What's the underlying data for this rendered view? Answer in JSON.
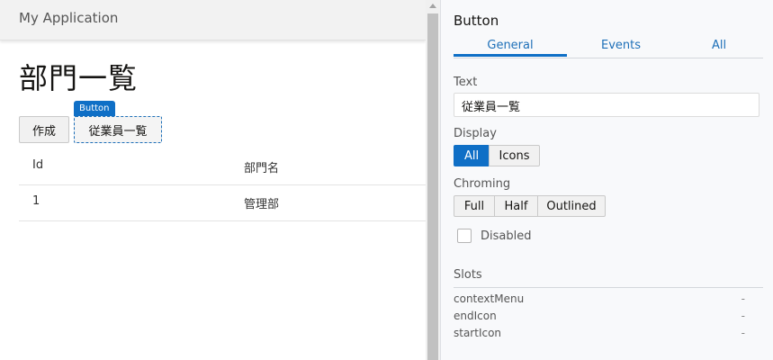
{
  "app": {
    "title": "My Application"
  },
  "page": {
    "heading": "部門一覧",
    "create_button": "作成",
    "employees_button": "従業員一覧",
    "selection_badge": "Button"
  },
  "table": {
    "columns": [
      "Id",
      "部門名"
    ],
    "rows": [
      [
        "1",
        "管理部"
      ]
    ]
  },
  "panel": {
    "title": "Button",
    "tabs": [
      {
        "label": "General",
        "active": true
      },
      {
        "label": "Events",
        "active": false
      },
      {
        "label": "All",
        "active": false
      }
    ],
    "text_label": "Text",
    "text_value": "従業員一覧",
    "display_label": "Display",
    "display_options": [
      {
        "label": "All",
        "active": true
      },
      {
        "label": "Icons",
        "active": false
      }
    ],
    "chroming_label": "Chroming",
    "chroming_options": [
      {
        "label": "Full",
        "active": false
      },
      {
        "label": "Half",
        "active": false
      },
      {
        "label": "Outlined",
        "active": false
      }
    ],
    "disabled_label": "Disabled",
    "disabled_checked": false,
    "slots_label": "Slots",
    "slots": [
      {
        "name": "contextMenu",
        "value": "-"
      },
      {
        "name": "endIcon",
        "value": "-"
      },
      {
        "name": "startIcon",
        "value": "-"
      }
    ]
  },
  "colors": {
    "accent": "#0f6fc6",
    "header_bg": "#f2f2f2",
    "panel_bg": "#f8f9fb"
  }
}
